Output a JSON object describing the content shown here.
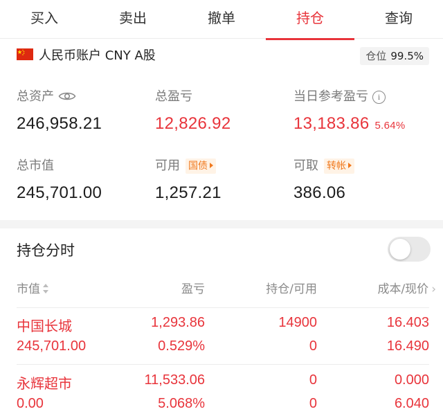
{
  "tabs": [
    {
      "label": "买入",
      "active": false
    },
    {
      "label": "卖出",
      "active": false
    },
    {
      "label": "撤单",
      "active": false
    },
    {
      "label": "持仓",
      "active": true
    },
    {
      "label": "查询",
      "active": false
    }
  ],
  "account": {
    "flag_icon": "china-flag-icon",
    "label": "人民币账户 CNY A股",
    "position_label": "仓位",
    "position_value": "99.5%"
  },
  "stats": {
    "total_assets": {
      "label": "总资产",
      "value": "246,958.21"
    },
    "total_pnl": {
      "label": "总盈亏",
      "value": "12,826.92"
    },
    "daily_pnl": {
      "label": "当日参考盈亏",
      "value": "13,183.86",
      "pct": "5.64%"
    },
    "market_value": {
      "label": "总市值",
      "value": "245,701.00"
    },
    "available": {
      "label": "可用",
      "value": "1,257.21",
      "tag": "国债"
    },
    "withdrawable": {
      "label": "可取",
      "value": "386.06",
      "tag": "转帐"
    }
  },
  "holdings": {
    "title": "持仓分时",
    "toggle_on": false,
    "headers": {
      "market_value": "市值",
      "pnl": "盈亏",
      "position": "持仓/可用",
      "cost": "成本/现价"
    },
    "rows": [
      {
        "name": "中国长城",
        "market_value": "245,701.00",
        "pnl": "1,293.86",
        "pnl_pct": "0.529%",
        "position": "14900",
        "available": "0",
        "cost": "16.403",
        "price": "16.490"
      },
      {
        "name": "永辉超市",
        "market_value": "0.00",
        "pnl": "11,533.06",
        "pnl_pct": "5.068%",
        "position": "0",
        "available": "0",
        "cost": "0.000",
        "price": "6.040"
      }
    ]
  },
  "colors": {
    "accent": "#e8343b",
    "tag": "#f0791e"
  }
}
